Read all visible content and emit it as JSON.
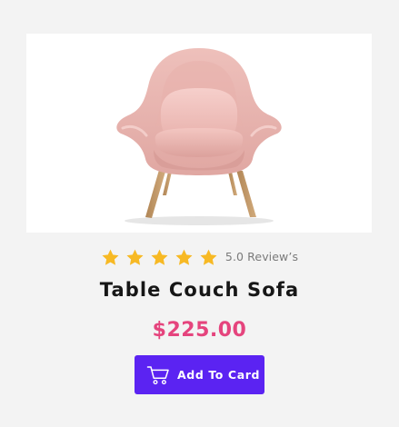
{
  "product": {
    "title": "Table Couch Sofa",
    "price": "$225.00",
    "image_alt": "pink-armchair",
    "rating": {
      "stars": 5,
      "max_stars": 5,
      "label": "5.0 Review’s"
    }
  },
  "actions": {
    "add_to_cart_label": "Add To Card"
  },
  "icons": {
    "star": "star-icon",
    "cart": "shopping-cart-icon"
  },
  "colors": {
    "page_background": "#f3f3f3",
    "image_panel": "#ffffff",
    "star": "#f7b924",
    "price": "#e5447d",
    "button": "#5b23f2",
    "button_text": "#ffffff",
    "title": "#161616"
  }
}
